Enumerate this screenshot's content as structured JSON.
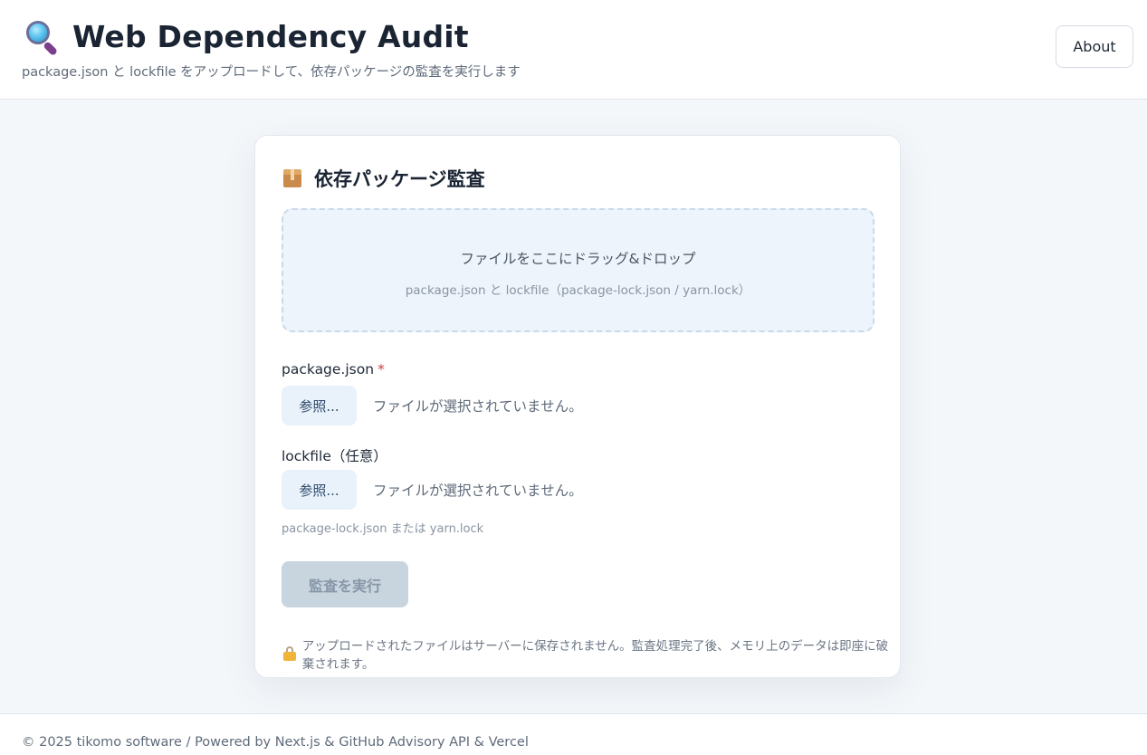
{
  "header": {
    "title": "Web Dependency Audit",
    "title_icon": "magnifying-glass-icon",
    "subtitle": "package.json と lockfile をアップロードして、依存パッケージの監査を実行します",
    "about_label": "About"
  },
  "card": {
    "title": "依存パッケージ監査",
    "title_icon": "package-box-icon",
    "dropzone": {
      "main_text": "ファイルをここにドラッグ&ドロップ",
      "hint_text": "package.json と lockfile（package-lock.json / yarn.lock）"
    },
    "package_json": {
      "label": "package.json",
      "required_mark": "*",
      "browse_label": "参照...",
      "status": "ファイルが選択されていません。"
    },
    "lockfile": {
      "label": "lockfile（任意）",
      "browse_label": "参照...",
      "status": "ファイルが選択されていません。",
      "helper": "package-lock.json または yarn.lock"
    },
    "run_label": "監査を実行",
    "privacy_icon": "lock-icon",
    "privacy_text": "アップロードされたファイルはサーバーに保存されません。監査処理完了後、メモリ上のデータは即座に破棄されます。"
  },
  "footer": {
    "text": "© 2025 tikomo software / Powered by Next.js & GitHub Advisory API & Vercel"
  },
  "colors": {
    "page_background": "#f4f7fa",
    "dropzone_background": "#eef4fb",
    "browse_button": "#e9f2fb",
    "run_button_disabled": "#c8d4de",
    "required": "#d23c3c"
  }
}
